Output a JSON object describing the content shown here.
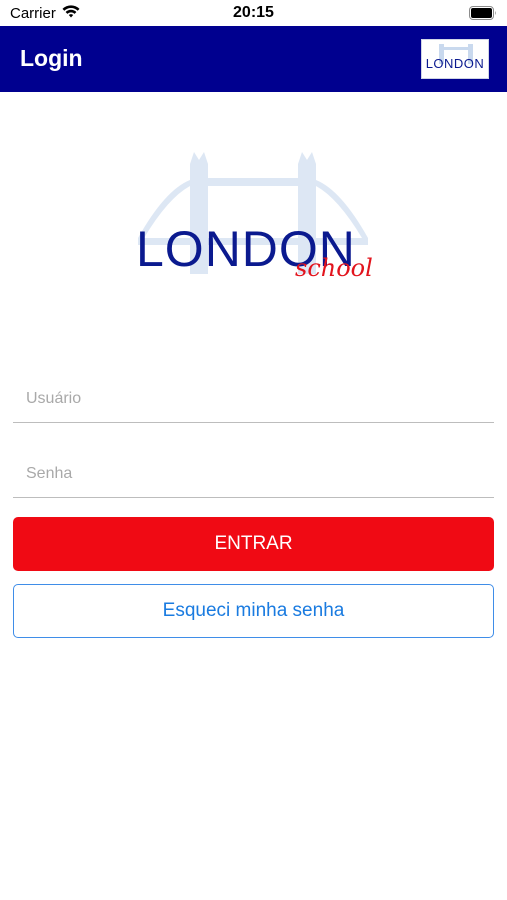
{
  "status_bar": {
    "carrier": "Carrier",
    "time": "20:15",
    "wifi_icon": "wifi-icon",
    "battery_icon": "battery-icon"
  },
  "nav_bar": {
    "title": "Login",
    "logo_text": "LONDON",
    "background_color": "#00008f"
  },
  "logo": {
    "word": "LONDON",
    "script": "school",
    "word_color": "#0b1a8f",
    "script_color": "#e2141d"
  },
  "form": {
    "username_placeholder": "Usuário",
    "password_placeholder": "Senha",
    "submit_label": "ENTRAR",
    "forgot_label": "Esqueci minha senha",
    "submit_color": "#f00a14",
    "forgot_color": "#1a7be0"
  }
}
